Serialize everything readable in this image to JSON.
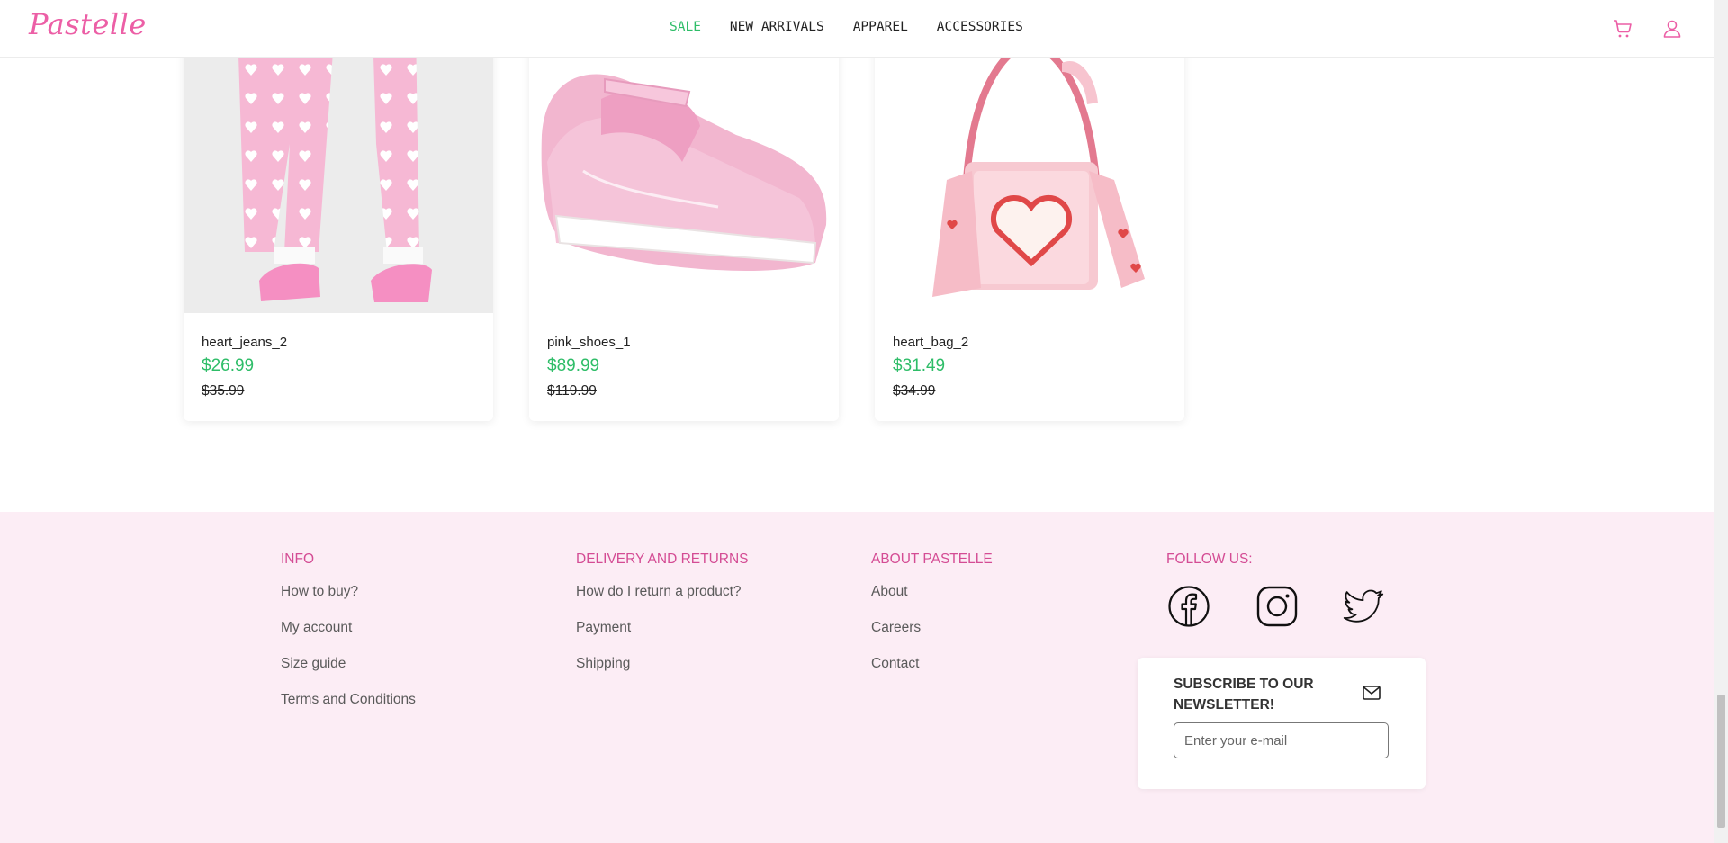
{
  "header": {
    "logo": "Pastelle",
    "nav": [
      "SALE",
      "NEW ARRIVALS",
      "APPAREL",
      "ACCESSORIES"
    ]
  },
  "products": [
    {
      "name": "heart_jeans_2",
      "price": "$26.99",
      "old_price": "$35.99"
    },
    {
      "name": "pink_shoes_1",
      "price": "$89.99",
      "old_price": "$119.99"
    },
    {
      "name": "heart_bag_2",
      "price": "$31.49",
      "old_price": "$34.99"
    }
  ],
  "footer": {
    "columns": [
      {
        "title": "INFO",
        "links": [
          "How to buy?",
          "My account",
          "Size guide",
          "Terms and Conditions"
        ]
      },
      {
        "title": "DELIVERY AND RETURNS",
        "links": [
          "How do I return a product?",
          "Payment",
          "Shipping"
        ]
      },
      {
        "title": "ABOUT PASTELLE",
        "links": [
          "About",
          "Careers",
          "Contact"
        ]
      }
    ],
    "follow_title": "FOLLOW US:",
    "social": [
      "facebook-icon",
      "instagram-icon",
      "twitter-icon"
    ],
    "newsletter": {
      "title": "SUBSCRIBE TO OUR NEWSLETTER!",
      "placeholder": "Enter your e-mail"
    }
  },
  "colors": {
    "accent_pink": "#ec5fa6",
    "sale_green": "#2ebd68",
    "footer_bg": "#fcedf5",
    "footer_heading": "#d44c94"
  }
}
